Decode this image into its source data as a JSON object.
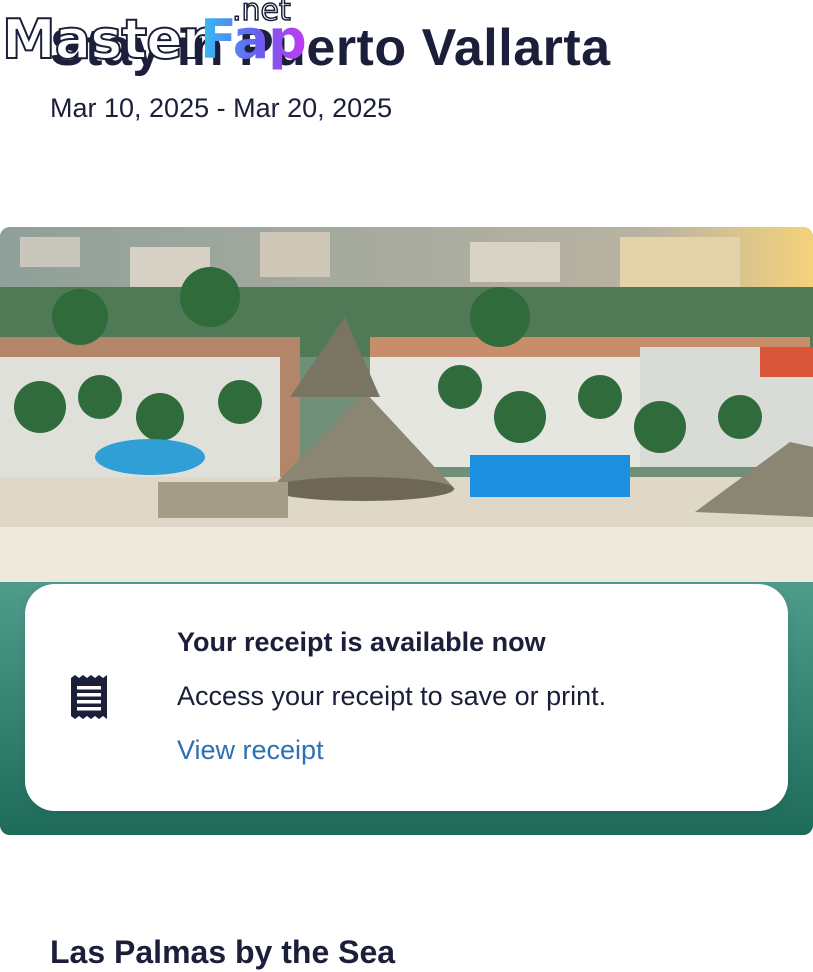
{
  "trip": {
    "title": "Stay in Puerto Vallarta",
    "dates": "Mar 10, 2025 - Mar 20, 2025"
  },
  "watermark": {
    "part1": "Master",
    "part2": "Fap",
    "part3": ".net"
  },
  "hero": {
    "image_description_icon": "resort-photo"
  },
  "receipt": {
    "title": "Your receipt is available now",
    "description": "Access your receipt to save or print.",
    "link_label": "View receipt",
    "icon": "receipt-icon"
  },
  "hotel": {
    "name": "Las Palmas by the Sea"
  },
  "colors": {
    "text": "#1b1f3a",
    "link": "#2f6fb3",
    "background": "#ffffff"
  }
}
